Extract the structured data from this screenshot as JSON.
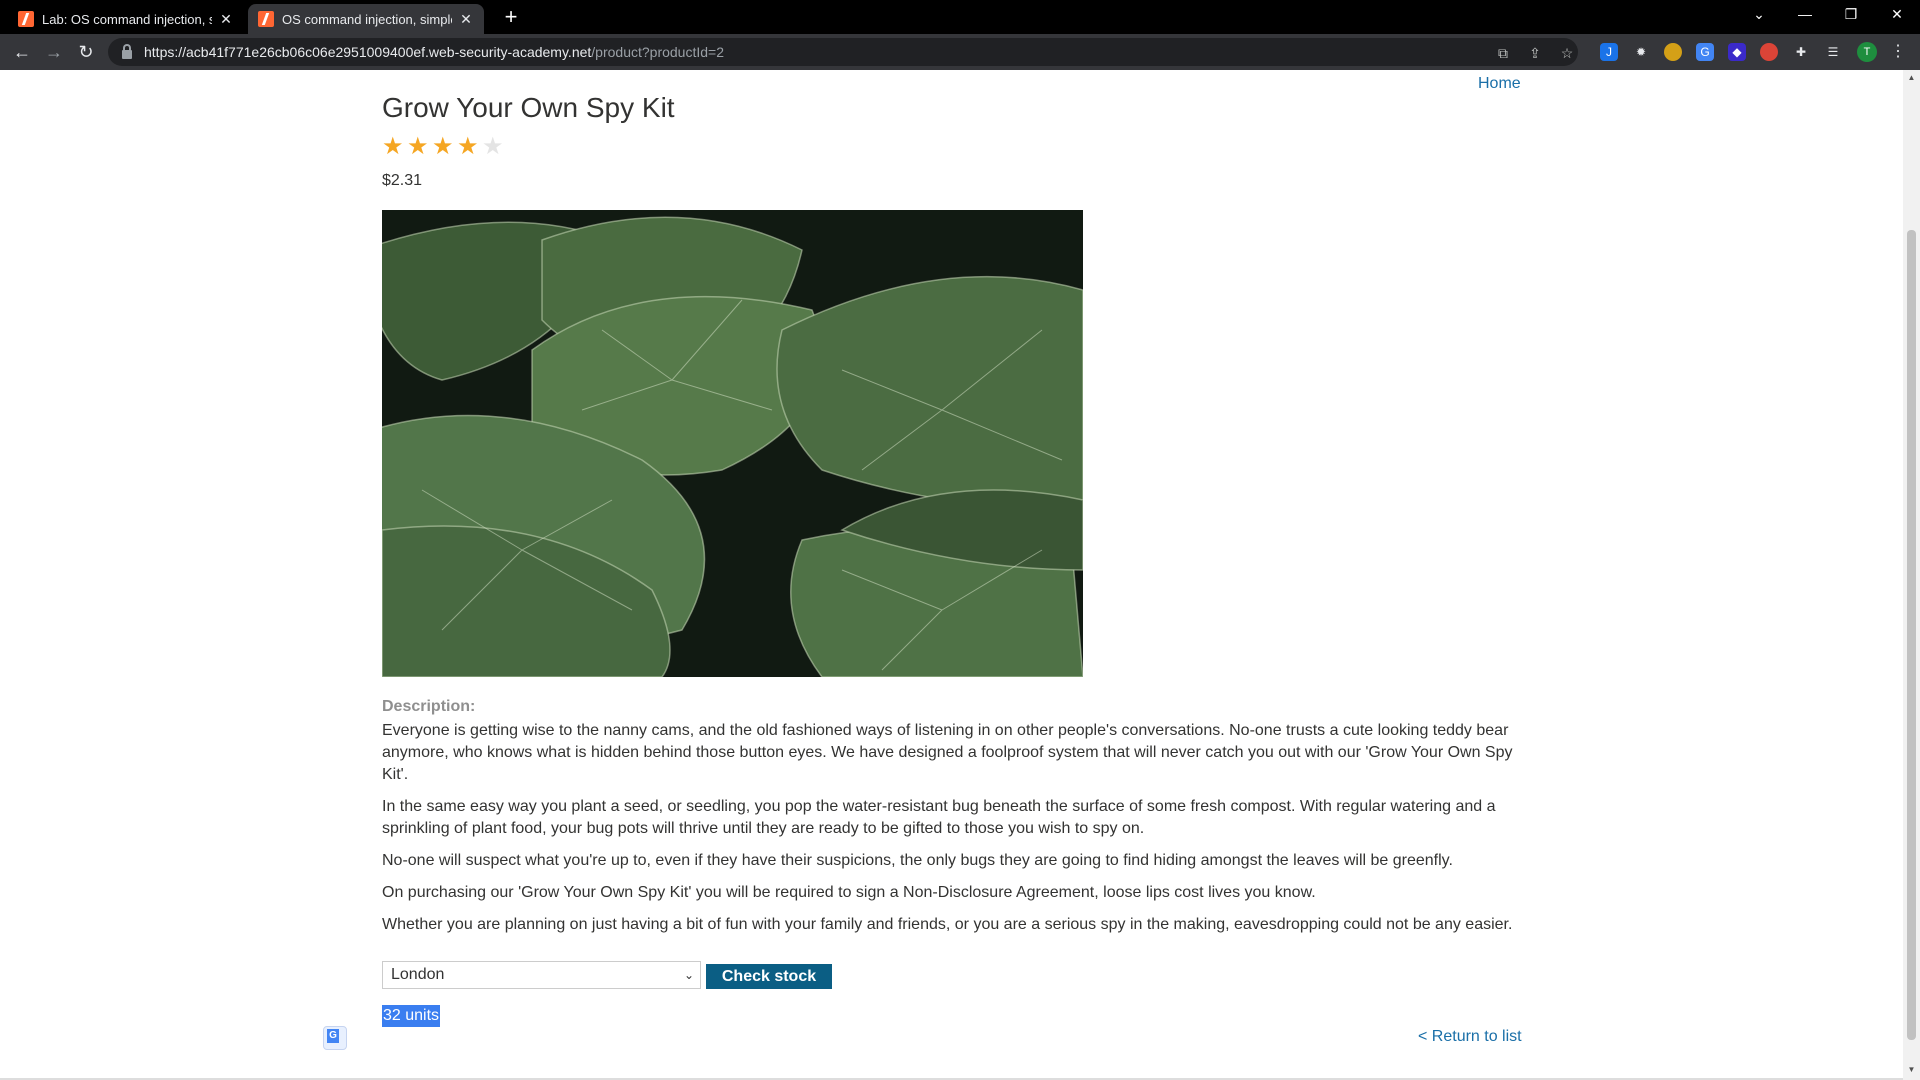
{
  "browser": {
    "tabs": [
      {
        "title": "Lab: OS command injection, simp",
        "active": false
      },
      {
        "title": "OS command injection, simple ca",
        "active": true
      }
    ],
    "url_host": "https://acb41f771e26cb06c06e2951009400ef.web-security-academy.net",
    "url_path": "/product?productId=2",
    "profile_initial": "T"
  },
  "nav": {
    "home": "Home",
    "return": "< Return to list"
  },
  "product": {
    "title": "Grow Your Own Spy Kit",
    "rating": 4,
    "rating_max": 5,
    "price": "$2.31",
    "description_label": "Description:",
    "description": [
      "Everyone is getting wise to the nanny cams, and the old fashioned ways of listening in on other people's conversations. No-one trusts a cute looking teddy bear anymore, who knows what is hidden behind those button eyes. We have designed a foolproof system that will never catch you out with our 'Grow Your Own Spy Kit'.",
      "In the same easy way you plant a seed, or seedling, you pop the water-resistant bug beneath the surface of some fresh compost. With regular watering and a sprinkling of plant food, your bug pots will thrive until they are ready to be gifted to those you wish to spy on.",
      "No-one will suspect what you're up to, even if they have their suspicions, the only bugs they are going to find hiding amongst the leaves will be greenfly.",
      "On purchasing our 'Grow Your Own Spy Kit' you will be required to sign a Non-Disclosure Agreement, loose lips cost lives you know.",
      "Whether you are planning on just having a bit of fun with your family and friends, or you are a serious spy in the making, eavesdropping could not be any easier."
    ]
  },
  "stock": {
    "selected_store": "London",
    "check_label": "Check stock",
    "result": "32 units"
  },
  "colors": {
    "link": "#1a6fa8",
    "button": "#0b5e84",
    "star": "#f5a623"
  }
}
